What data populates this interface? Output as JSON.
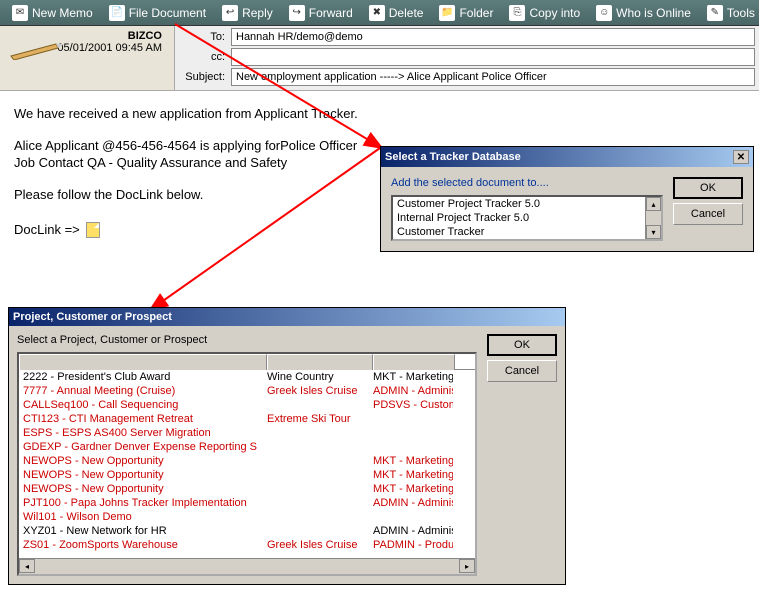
{
  "toolbar": {
    "items": [
      {
        "label": "New Memo",
        "icon": "✉"
      },
      {
        "label": "File Document",
        "icon": "📄"
      },
      {
        "label": "Reply",
        "icon": "↩"
      },
      {
        "label": "Forward",
        "icon": "↪"
      },
      {
        "label": "Delete",
        "icon": "✖"
      },
      {
        "label": "Folder",
        "icon": "📁"
      },
      {
        "label": "Copy into",
        "icon": "⎘"
      },
      {
        "label": "Who is Online",
        "icon": "☺"
      },
      {
        "label": "Tools",
        "icon": "✎"
      }
    ]
  },
  "header": {
    "company": "BIZCO",
    "datetime": "05/01/2001 09:45 AM",
    "to_label": "To:",
    "cc_label": "cc:",
    "subject_label": "Subject:",
    "to": "Hannah HR/demo@demo",
    "cc": "",
    "subject": "New employment application -----> Alice Applicant Police Officer"
  },
  "body": {
    "line1": "We have received  a new application from Applicant Tracker.",
    "line2": "Alice Applicant @456-456-4564 is applying forPolice Officer",
    "line3": "Job Contact QA - Quality Assurance and Safety",
    "line4": "Please follow the DocLink below.",
    "doclink_label": "DocLink =>"
  },
  "tracker_dialog": {
    "title": "Select a Tracker Database",
    "instruction": "Add the selected document to....",
    "items": [
      "Customer Project Tracker 5.0",
      "Internal Project Tracker 5.0",
      "Customer Tracker"
    ],
    "ok": "OK",
    "cancel": "Cancel"
  },
  "project_dialog": {
    "title": "Project, Customer or Prospect",
    "instruction": "Select a Project, Customer or Prospect",
    "ok": "OK",
    "cancel": "Cancel",
    "rows": [
      {
        "c1": "2222 - President's Club Award",
        "c2": "Wine Country",
        "c3": "MKT - Marketing",
        "cls": "black"
      },
      {
        "c1": "7777 - Annual Meeting (Cruise)",
        "c2": "Greek Isles Cruise",
        "c3": "ADMIN - Adminis",
        "cls": "red"
      },
      {
        "c1": "CALLSeq100 - Call Sequencing",
        "c2": "",
        "c3": "PDSVS - Custom",
        "cls": "red"
      },
      {
        "c1": "CTI123 - CTI Management Retreat",
        "c2": "Extreme Ski Tour",
        "c3": "",
        "cls": "red"
      },
      {
        "c1": "ESPS - ESPS AS400 Server Migration",
        "c2": "",
        "c3": "",
        "cls": "red"
      },
      {
        "c1": "GDEXP - Gardner Denver Expense Reporting S",
        "c2": "",
        "c3": "",
        "cls": "red"
      },
      {
        "c1": "NEWOPS - New Opportunity",
        "c2": "",
        "c3": "MKT - Marketing",
        "cls": "red"
      },
      {
        "c1": "NEWOPS - New Opportunity",
        "c2": "",
        "c3": "MKT - Marketing",
        "cls": "red"
      },
      {
        "c1": "NEWOPS - New Opportunity",
        "c2": "",
        "c3": "MKT - Marketing",
        "cls": "red"
      },
      {
        "c1": "PJT100 - Papa Johns Tracker Implementation",
        "c2": "",
        "c3": "ADMIN - Adminis",
        "cls": "red"
      },
      {
        "c1": "Wil101 - Wilson Demo",
        "c2": "",
        "c3": "",
        "cls": "red"
      },
      {
        "c1": "XYZ01 - New Network for HR",
        "c2": "",
        "c3": "ADMIN - Adminis",
        "cls": "black"
      },
      {
        "c1": "ZS01 - ZoomSports Warehouse",
        "c2": "Greek Isles Cruise",
        "c3": "PADMIN - Produ",
        "cls": "red"
      }
    ]
  }
}
